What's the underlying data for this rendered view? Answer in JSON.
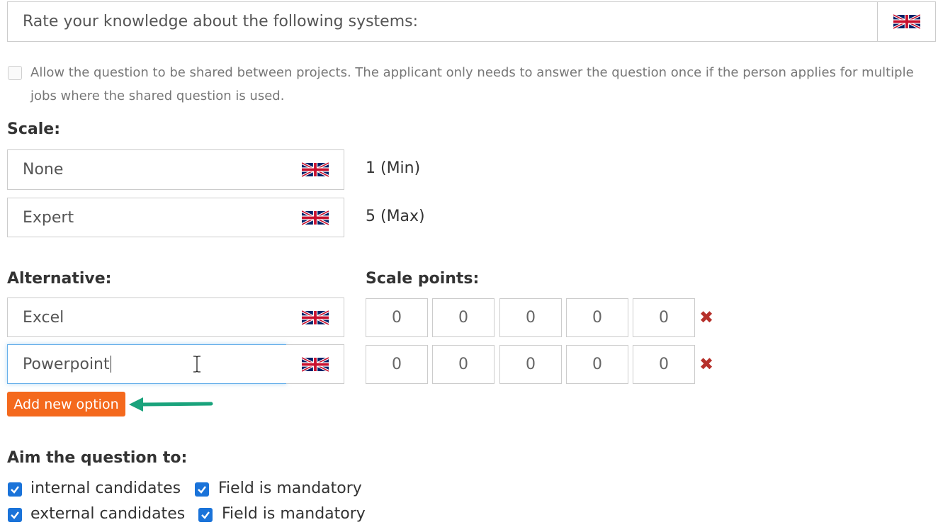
{
  "question": {
    "value": "Rate your knowledge about the following systems:",
    "language_flag": "uk-flag-icon"
  },
  "share": {
    "checked": false,
    "line1": "Allow the question to be shared between projects. The applicant only needs to answer the question once if the person applies for multiple",
    "line2": "jobs where the shared question is used."
  },
  "scale": {
    "label": "Scale:",
    "min": {
      "value": "None",
      "note": "1 (Min)"
    },
    "max": {
      "value": "Expert",
      "note": "5 (Max)"
    }
  },
  "alternatives": {
    "label": "Alternative:",
    "points_label": "Scale points:",
    "rows": [
      {
        "value": "Excel",
        "points": [
          "0",
          "0",
          "0",
          "0",
          "0"
        ],
        "focused": false
      },
      {
        "value": "Powerpoint",
        "points": [
          "0",
          "0",
          "0",
          "0",
          "0"
        ],
        "focused": true
      }
    ],
    "delete_icon": "✖",
    "add_button": "Add new option"
  },
  "aim": {
    "label": "Aim the question to:",
    "rows": [
      {
        "target": "internal candidates",
        "target_checked": true,
        "mandatory": "Field is mandatory",
        "mandatory_checked": true
      },
      {
        "target": "external candidates",
        "target_checked": true,
        "mandatory": "Field is mandatory",
        "mandatory_checked": true
      }
    ]
  },
  "colors": {
    "accent_button": "#f4691d",
    "checkbox": "#1a73d9",
    "delete": "#b6312b",
    "annotation_arrow": "#1aa37c"
  }
}
